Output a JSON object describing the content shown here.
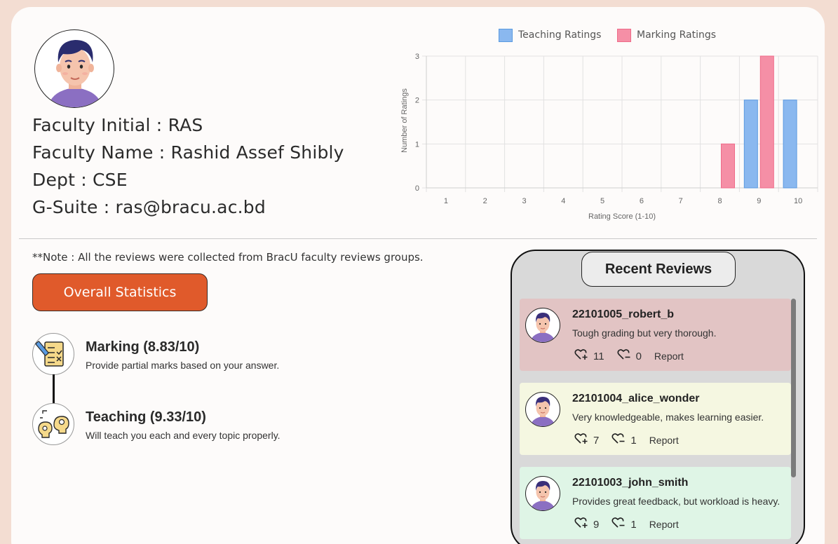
{
  "faculty": {
    "initial_line": "Faculty Initial : RAS",
    "name_line": "Faculty Name : Rashid Assef Shibly",
    "dept_line": "Dept : CSE",
    "gsuite_line": "G-Suite : ras@bracu.ac.bd"
  },
  "note": "**Note : All the reviews were collected from BracU faculty reviews groups.",
  "overall_button": "Overall Statistics",
  "stats": [
    {
      "title": "Marking (8.83/10)",
      "desc": "Provide partial marks based on your answer.",
      "icon": "marking-sheet-icon"
    },
    {
      "title": "Teaching (9.33/10)",
      "desc": "Will teach you each and every topic properly.",
      "icon": "teaching-ideas-icon"
    }
  ],
  "reviews_title": "Recent Reviews",
  "reviews": [
    {
      "user": "22101005_robert_b",
      "text": "Tough grading but very thorough.",
      "likes": "11",
      "dislikes": "0",
      "report": "Report",
      "bg": "#e2c4c4"
    },
    {
      "user": "22101004_alice_wonder",
      "text": "Very knowledgeable, makes learning easier.",
      "likes": "7",
      "dislikes": "1",
      "report": "Report",
      "bg": "#f5f7e1"
    },
    {
      "user": "22101003_john_smith",
      "text": "Provides great feedback, but workload is heavy.",
      "likes": "9",
      "dislikes": "1",
      "report": "Report",
      "bg": "#dff5e6"
    }
  ],
  "chart_data": {
    "type": "bar",
    "categories": [
      "1",
      "2",
      "3",
      "4",
      "5",
      "6",
      "7",
      "8",
      "9",
      "10"
    ],
    "series": [
      {
        "name": "Teaching Ratings",
        "values": [
          0,
          0,
          0,
          0,
          0,
          0,
          0,
          0,
          2,
          2
        ],
        "color": "#8ab8ef",
        "border": "#5a9ae0"
      },
      {
        "name": "Marking Ratings",
        "values": [
          0,
          0,
          0,
          0,
          0,
          0,
          0,
          1,
          3,
          0
        ],
        "color": "#f58fa6",
        "border": "#ef6b89"
      }
    ],
    "xlabel": "Rating Score (1-10)",
    "ylabel": "Number of Ratings",
    "ylim": [
      0,
      3
    ],
    "yticks": [
      "0",
      "1",
      "2",
      "3"
    ],
    "grid": true,
    "legend": "top"
  }
}
